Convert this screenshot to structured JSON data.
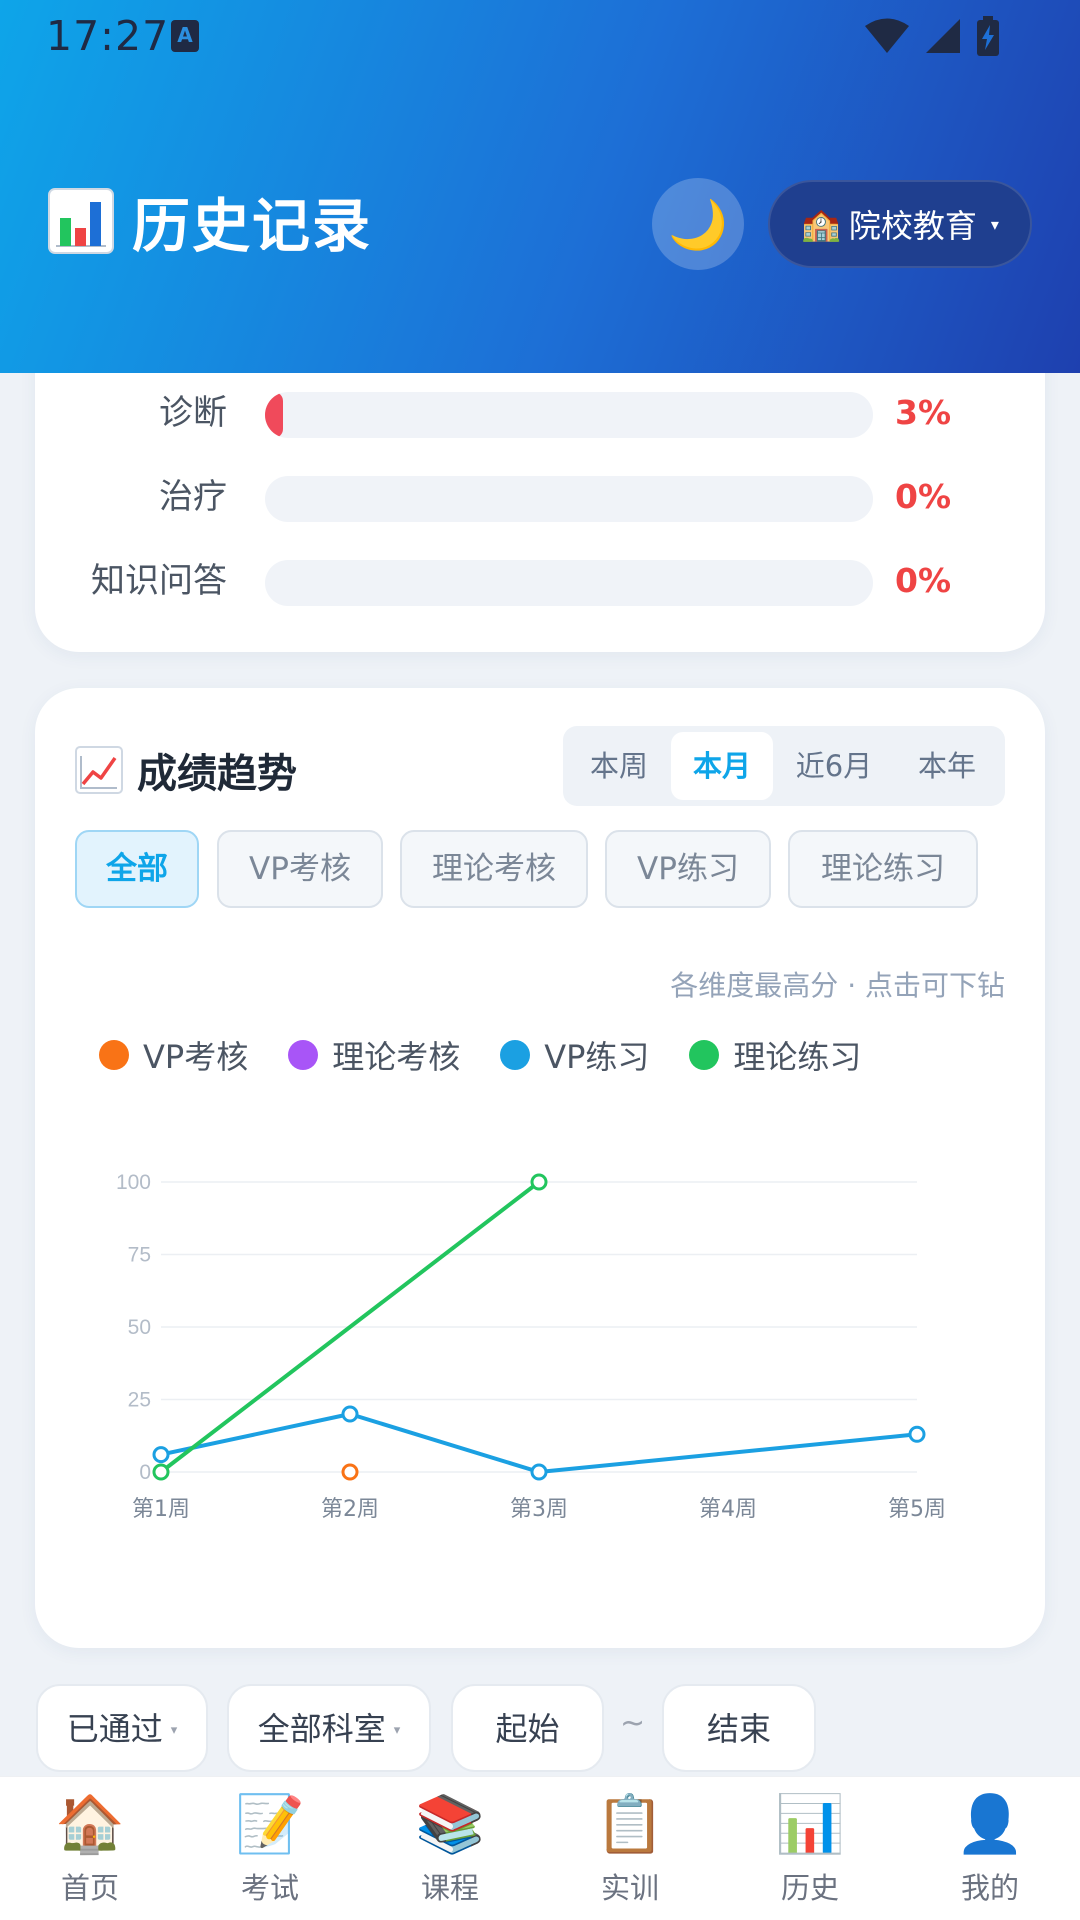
{
  "status_bar": {
    "time": "17:27",
    "notification_icon": "A"
  },
  "header": {
    "title": "历史记录",
    "title_icon": "bar-chart-emoji",
    "theme_toggle_icon": "🌙",
    "school_switch": {
      "icon": "🏫",
      "label": "院校教育",
      "caret": "▾"
    }
  },
  "progress_card": {
    "rows": [
      {
        "label": "诊断",
        "value_text": "3%",
        "fraction": 0.03
      },
      {
        "label": "治疗",
        "value_text": "0%",
        "fraction": 0.0
      },
      {
        "label": "知识问答",
        "value_text": "0%",
        "fraction": 0.0
      }
    ],
    "fill_color": "#f04a5b"
  },
  "trend_card": {
    "title": "成绩趋势",
    "title_icon": "trend-up-emoji",
    "periods": [
      "本周",
      "本月",
      "近6月",
      "本年"
    ],
    "active_period": "本月",
    "filters": [
      "全部",
      "VP考核",
      "理论考核",
      "VP练习",
      "理论练习"
    ],
    "active_filter": "全部",
    "hint": "各维度最高分 · 点击可下钻",
    "legend": [
      {
        "label": "VP考核",
        "color": "#f97316"
      },
      {
        "label": "理论考核",
        "color": "#a855f7"
      },
      {
        "label": "VP练习",
        "color": "#1ba0e2"
      },
      {
        "label": "理论练习",
        "color": "#22c55e"
      }
    ]
  },
  "chart_data": {
    "type": "line",
    "categories": [
      "第1周",
      "第2周",
      "第3周",
      "第4周",
      "第5周"
    ],
    "y_ticks": [
      0,
      25,
      50,
      75,
      100
    ],
    "ylim": [
      0,
      100
    ],
    "grid": true,
    "series": [
      {
        "name": "VP考核",
        "color": "#f97316",
        "values": [
          null,
          0,
          null,
          null,
          null
        ]
      },
      {
        "name": "理论考核",
        "color": "#a855f7",
        "values": [
          null,
          null,
          null,
          null,
          null
        ]
      },
      {
        "name": "VP练习",
        "color": "#1ba0e2",
        "values": [
          6,
          20,
          0,
          null,
          13
        ]
      },
      {
        "name": "理论练习",
        "color": "#22c55e",
        "values": [
          0,
          null,
          100,
          null,
          null
        ]
      }
    ]
  },
  "filter_bar": {
    "status": "已通过",
    "department": "全部科室",
    "start_label": "起始",
    "separator": "~",
    "end_label": "结束",
    "caret": "▾"
  },
  "bottom_nav": [
    {
      "key": "home",
      "label": "首页",
      "icon": "🏠"
    },
    {
      "key": "exam",
      "label": "考试",
      "icon": "📝"
    },
    {
      "key": "course",
      "label": "课程",
      "icon": "📚"
    },
    {
      "key": "training",
      "label": "实训",
      "icon": "📋"
    },
    {
      "key": "history",
      "label": "历史",
      "icon": "📊"
    },
    {
      "key": "mine",
      "label": "我的",
      "icon": "👤"
    }
  ]
}
